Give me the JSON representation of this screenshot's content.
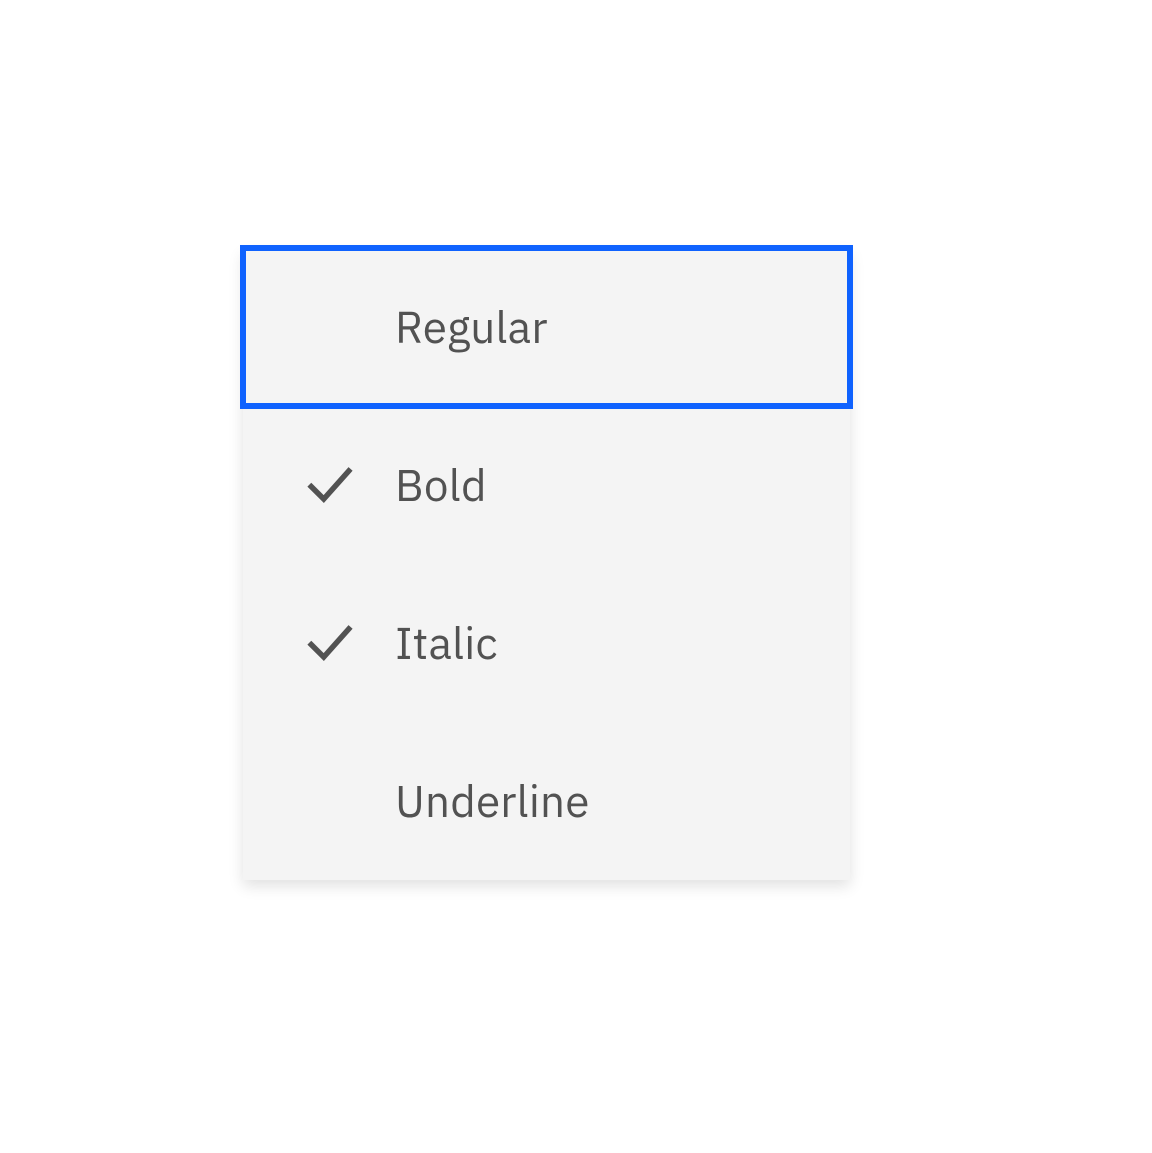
{
  "menu": {
    "items": [
      {
        "label": "Regular",
        "checked": false,
        "focused": true
      },
      {
        "label": "Bold",
        "checked": true,
        "focused": false
      },
      {
        "label": "Italic",
        "checked": true,
        "focused": false
      },
      {
        "label": "Underline",
        "checked": false,
        "focused": false
      }
    ]
  },
  "colors": {
    "focus": "#0f62fe",
    "background": "#f4f4f4",
    "text": "#525252"
  }
}
